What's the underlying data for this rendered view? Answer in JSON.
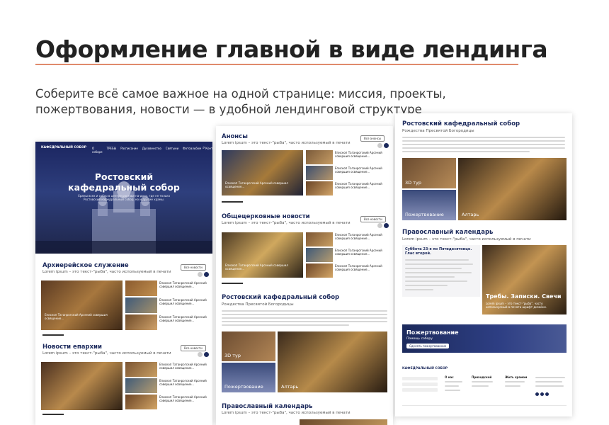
{
  "headline": "Оформление главной в виде лендинга",
  "lead": "Соберите всё самое важное на одной странице: миссия, проекты, пожертвования, новости — в удобной лендинговой структуре",
  "colors": {
    "accent": "#e08a6c",
    "navy": "#1c2a5c"
  },
  "left": {
    "site_name": "КАФЕДРАЛЬНЫЙ СОБОР",
    "nav": [
      "О соборе",
      "ТРЕБЫ",
      "Расписание",
      "Духовенство",
      "Святыни",
      "Фотоальбом",
      "Контакты"
    ],
    "hero_title": "Ростовский кафедральный собор",
    "hero_text": "Храмы всех и собор в центре ростова-на-дону, где не только Ростовский кафедральный собор, но и другие храмы.",
    "sec1_title": "Архиерейское служение",
    "sec1_sub": "Lorem ipsum – это текст-\"рыба\", часто используемый в печати",
    "all_btn": "Все новости",
    "sec2_title": "Новости епархии",
    "sec2_sub": "Lorem ipsum – это текст-\"рыба\", часто используемый в печати",
    "news_item": "Епископ Таганрогский Арсений совершил освящение...",
    "more": "Подробнее"
  },
  "middle": {
    "s1_title": "Анонсы",
    "s1_sub": "Lorem ipsum – это текст-\"рыба\", часто используемый в печати",
    "s2_title": "Общецерковные новости",
    "s2_sub": "Lorem ipsum – это текст-\"рыба\", часто используемый в печати",
    "all_btn": "Все анонсы",
    "all_btn2": "Все новости",
    "feat": "Епископ Таганрогский Арсений совершил освящение...",
    "news_item": "Епископ Таганрогский Арсений совершил освящение...",
    "more": "Подробнее",
    "s3_title": "Ростовский кафедральный собор",
    "s3_sub": "Рождества Пресвятой Богородицы",
    "tour": "3D тур",
    "ph1": "Пожертвование",
    "ph2": "Алтарь",
    "s4_title": "Православный календарь",
    "s4_sub": "Lorem ipsum – это текст-\"рыба\", часто используемый в печати"
  },
  "right": {
    "s1_title": "Ростовский кафедральный собор",
    "s1_sub": "Рождества Пресвятой Богородицы",
    "tour": "3D тур",
    "ph1": "Пожертвование",
    "ph2": "Алтарь",
    "cal_title": "Православный календарь",
    "cal_sub": "Lorem ipsum – это текст-\"рыба\", часто используемый в печати",
    "cal_date": "Суббота 23-я по Пятидесятнице. Глас второй.",
    "treby": "Требы. Записки. Свечи",
    "treby_sub": "Lorem ipsum – это текст-\"рыба\", часто используемый в печати шрифт дизайне.",
    "donate": "Пожертвование",
    "donate_sub": "Помощь собору",
    "donate_btn": "Сделать пожертвование",
    "footer_name": "КАФЕДРАЛЬНЫЙ СОБОР",
    "footer_cols": [
      "О нас",
      "Приходской",
      "Жить храмом"
    ]
  }
}
